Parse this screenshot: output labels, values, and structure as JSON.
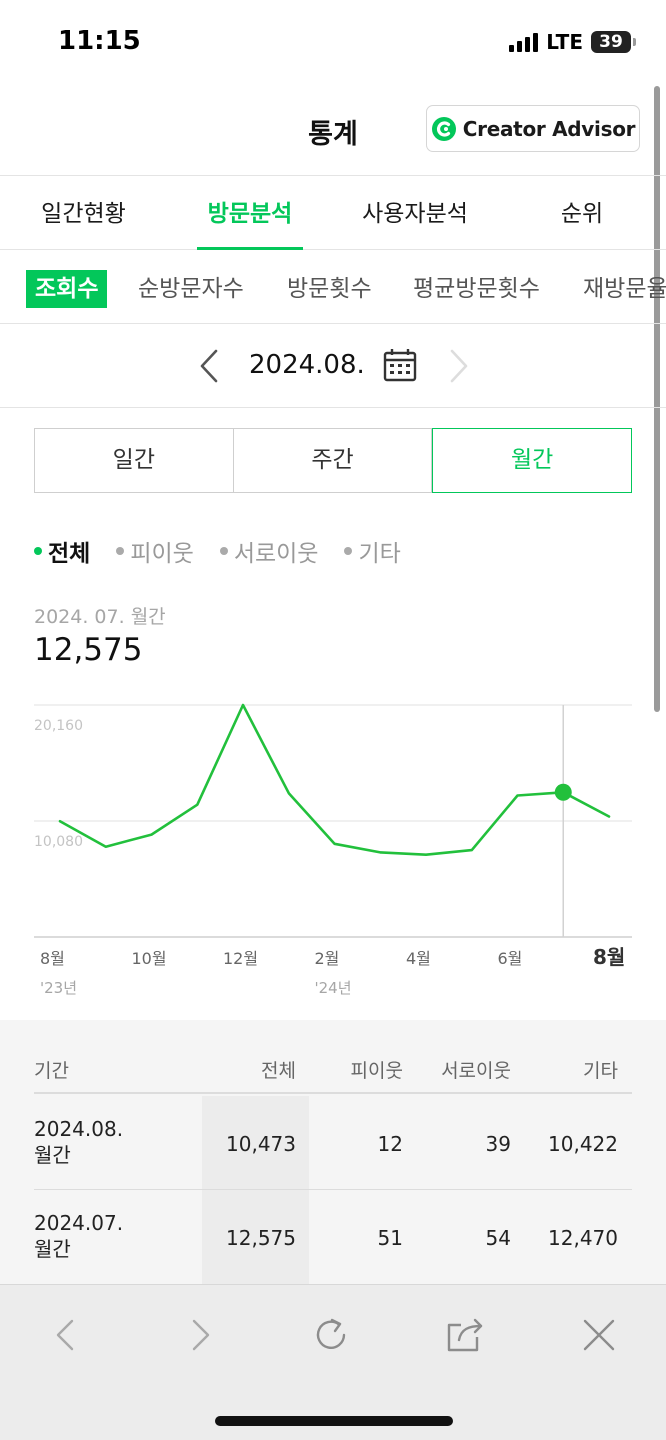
{
  "status_bar": {
    "time": "11:15",
    "network": "LTE",
    "battery": "39"
  },
  "header": {
    "title": "통계",
    "creator_advisor": "Creator Advisor"
  },
  "main_tabs": [
    {
      "label": "일간현황",
      "active": false
    },
    {
      "label": "방문분석",
      "active": true
    },
    {
      "label": "사용자분석",
      "active": false
    },
    {
      "label": "순위",
      "active": false
    }
  ],
  "sub_tabs": [
    {
      "label": "조회수",
      "active": true
    },
    {
      "label": "순방문자수",
      "active": false
    },
    {
      "label": "방문횟수",
      "active": false
    },
    {
      "label": "평균방문횟수",
      "active": false
    },
    {
      "label": "재방문율",
      "active": false
    }
  ],
  "date_nav": {
    "date": "2024.08."
  },
  "period_toggle": [
    {
      "label": "일간",
      "active": false
    },
    {
      "label": "주간",
      "active": false
    },
    {
      "label": "월간",
      "active": true
    }
  ],
  "filters": [
    {
      "label": "전체",
      "active": true
    },
    {
      "label": "피이웃",
      "active": false
    },
    {
      "label": "서로이웃",
      "active": false
    },
    {
      "label": "기타",
      "active": false
    }
  ],
  "selected": {
    "period_label": "2024. 07. 월간",
    "value": "12,575"
  },
  "chart_data": {
    "type": "line",
    "x": [
      "2023-08",
      "2023-09",
      "2023-10",
      "2023-11",
      "2023-12",
      "2024-01",
      "2024-02",
      "2024-03",
      "2024-04",
      "2024-05",
      "2024-06",
      "2024-07",
      "2024-08"
    ],
    "series": [
      {
        "values": [
          10060,
          7850,
          8900,
          11500,
          20160,
          12500,
          8100,
          7350,
          7150,
          7550,
          12300,
          12575,
          10473
        ]
      }
    ],
    "y_ticks": [
      "20,160",
      "10,080"
    ],
    "y_tick_values": [
      20160,
      10080
    ],
    "ylim": [
      0,
      20160
    ],
    "x_tick_labels": [
      "8월",
      "10월",
      "12월",
      "2월",
      "4월",
      "6월",
      "8월"
    ],
    "x_tick_index": [
      0,
      2,
      4,
      6,
      8,
      10,
      12
    ],
    "x_sub_labels": [
      "'23년",
      "'24년"
    ],
    "x_sub_index": [
      0,
      6
    ],
    "selected_index": 11,
    "line_color": "#22c03c",
    "grid": true
  },
  "table": {
    "headers": [
      "기간",
      "전체",
      "피이웃",
      "서로이웃",
      "기타"
    ],
    "rows": [
      {
        "period_1": "2024.08.",
        "period_2": "월간",
        "total": "10,473",
        "neighbor": "12",
        "mutual": "39",
        "other": "10,422"
      },
      {
        "period_1": "2024.07.",
        "period_2": "월간",
        "total": "12,575",
        "neighbor": "51",
        "mutual": "54",
        "other": "12,470"
      }
    ]
  },
  "colors": {
    "accent": "#03c75a",
    "chart_line": "#22c03c"
  },
  "toolbar_icons": [
    "back-icon",
    "forward-icon",
    "refresh-icon",
    "share-icon",
    "close-icon"
  ]
}
